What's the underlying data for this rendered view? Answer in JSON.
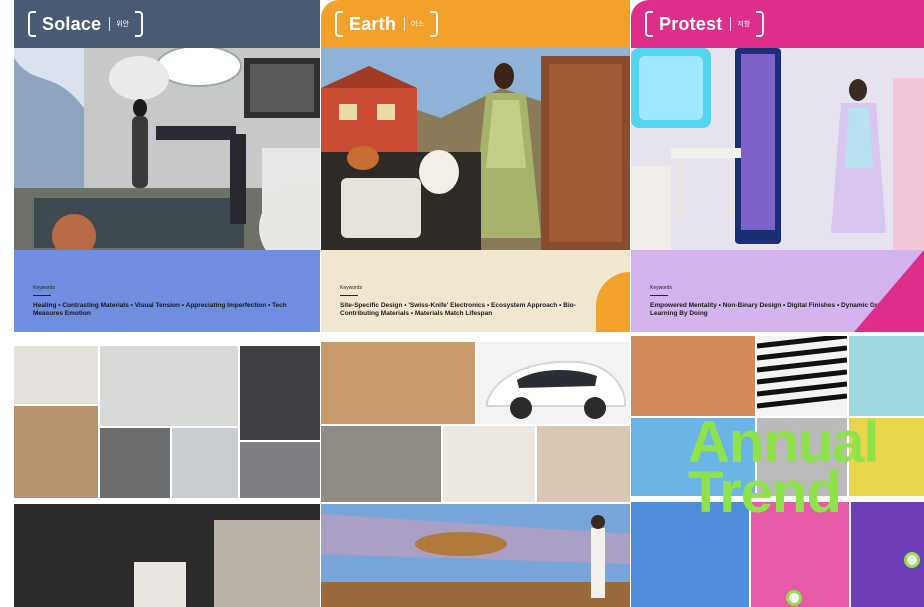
{
  "panels": [
    {
      "id": "solace",
      "title": "Solace",
      "korean": "위안",
      "description": "",
      "keywords_label": "Keywords",
      "keywords": "Healing • Contrasting Materials • Visual Tension • Appreciating Imperfection • Tech Measures Emotion",
      "colors": {
        "header": "#4a5a73",
        "keywords_bg": "#6f8ee0"
      }
    },
    {
      "id": "earth",
      "title": "Earth",
      "korean": "어스",
      "description": "",
      "keywords_label": "Keywords",
      "keywords": "Site-Specific Design • 'Swiss-Knife' Electronics • Ecosystem Approach • Bio-Contributing Materials • Materials Match Lifespan",
      "colors": {
        "header": "#f2a22a",
        "keywords_bg": "#f1e6cf"
      }
    },
    {
      "id": "protest",
      "title": "Protest",
      "korean": "저항",
      "description": "",
      "keywords_label": "Keywords",
      "keywords": "Empowered Mentality • Non-Binary Design • Digital Finishes • Dynamic Graphics • Learning By Doing",
      "colors": {
        "header": "#de2e8a",
        "keywords_bg": "#d3b4ee"
      }
    }
  ],
  "overlay": {
    "line1": "Annual",
    "line2": "Trend",
    "color": "#8fe34a"
  }
}
